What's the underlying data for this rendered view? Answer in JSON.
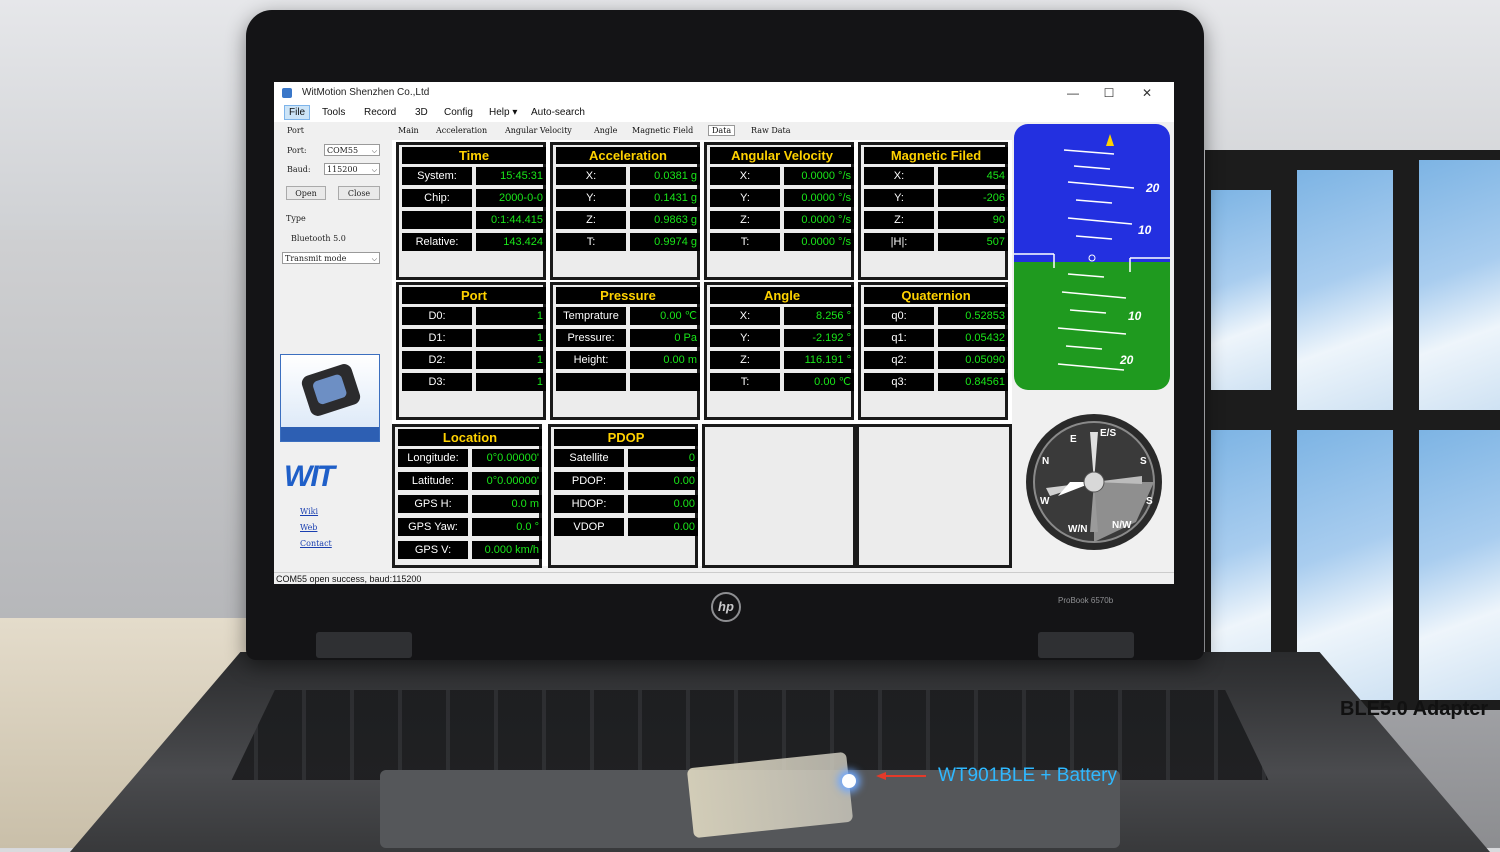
{
  "app": {
    "title": "WitMotion Shenzhen Co.,Ltd",
    "window_controls": {
      "minimize": "—",
      "maximize": "☐",
      "close": "✕"
    }
  },
  "menu": [
    "File",
    "Tools",
    "Record",
    "3D",
    "Config",
    "Help ▾",
    "Auto-search"
  ],
  "sidebar": {
    "port_group": "Port",
    "port_label": "Port:",
    "port_value": "COM55",
    "baud_label": "Baud:",
    "baud_value": "115200",
    "open_button": "Open",
    "close_button": "Close",
    "type_group": "Type",
    "type_value": "Bluetooth 5.0",
    "transmit_mode": "Transmit mode",
    "brand": "WIT",
    "links": [
      "Wiki",
      "Web",
      "Contact"
    ]
  },
  "tabs": [
    "Main",
    "Acceleration",
    "Angular Velocity",
    "Angle",
    "Magnetic Field",
    "Data",
    "Raw Data"
  ],
  "selected_tab": "Data",
  "panels": {
    "time": {
      "title": "Time",
      "rows": [
        {
          "label": "System:",
          "value": "15:45:31"
        },
        {
          "label": "Chip:",
          "value": "2000-0-0"
        },
        {
          "label": "",
          "value": "0:1:44.415"
        },
        {
          "label": "Relative:",
          "value": "143.424"
        }
      ]
    },
    "acceleration": {
      "title": "Acceleration",
      "rows": [
        {
          "label": "X:",
          "value": "0.0381 g"
        },
        {
          "label": "Y:",
          "value": "0.1431 g"
        },
        {
          "label": "Z:",
          "value": "0.9863 g"
        },
        {
          "label": "T:",
          "value": "0.9974 g"
        }
      ]
    },
    "angular_velocity": {
      "title": "Angular Velocity",
      "rows": [
        {
          "label": "X:",
          "value": "0.0000 °/s"
        },
        {
          "label": "Y:",
          "value": "0.0000 °/s"
        },
        {
          "label": "Z:",
          "value": "0.0000 °/s"
        },
        {
          "label": "T:",
          "value": "0.0000 °/s"
        }
      ]
    },
    "magnetic": {
      "title": "Magnetic Filed",
      "rows": [
        {
          "label": "X:",
          "value": "454"
        },
        {
          "label": "Y:",
          "value": "-206"
        },
        {
          "label": "Z:",
          "value": "90"
        },
        {
          "label": "|H|:",
          "value": "507"
        }
      ]
    },
    "port": {
      "title": "Port",
      "rows": [
        {
          "label": "D0:",
          "value": "1"
        },
        {
          "label": "D1:",
          "value": "1"
        },
        {
          "label": "D2:",
          "value": "1"
        },
        {
          "label": "D3:",
          "value": "1"
        }
      ]
    },
    "pressure": {
      "title": "Pressure",
      "rows": [
        {
          "label": "Temprature",
          "value": "0.00 ℃"
        },
        {
          "label": "Pressure:",
          "value": "0 Pa"
        },
        {
          "label": "Height:",
          "value": "0.00 m"
        },
        {
          "label": "",
          "value": ""
        }
      ]
    },
    "angle": {
      "title": "Angle",
      "rows": [
        {
          "label": "X:",
          "value": "8.256 °"
        },
        {
          "label": "Y:",
          "value": "-2.192 °"
        },
        {
          "label": "Z:",
          "value": "116.191 °"
        },
        {
          "label": "T:",
          "value": "0.00 ℃"
        }
      ]
    },
    "quaternion": {
      "title": "Quaternion",
      "rows": [
        {
          "label": "q0:",
          "value": "0.52853"
        },
        {
          "label": "q1:",
          "value": "0.05432"
        },
        {
          "label": "q2:",
          "value": "0.05090"
        },
        {
          "label": "q3:",
          "value": "0.84561"
        }
      ]
    },
    "location": {
      "title": "Location",
      "rows": [
        {
          "label": "Longitude:",
          "value": "0°0.00000'"
        },
        {
          "label": "Latitude:",
          "value": "0°0.00000'"
        },
        {
          "label": "GPS H:",
          "value": "0.0 m"
        },
        {
          "label": "GPS Yaw:",
          "value": "0.0 °"
        },
        {
          "label": "GPS V:",
          "value": "0.000 km/h"
        }
      ]
    },
    "pdop": {
      "title": "PDOP",
      "rows": [
        {
          "label": "Satellite",
          "value": "0"
        },
        {
          "label": "PDOP:",
          "value": "0.00"
        },
        {
          "label": "HDOP:",
          "value": "0.00"
        },
        {
          "label": "VDOP",
          "value": "0.00"
        }
      ]
    }
  },
  "attitude": {
    "labels": [
      "20",
      "10",
      "10",
      "20"
    ]
  },
  "compass": {
    "labels": [
      "E",
      "E/S",
      "N",
      "S",
      "W",
      "S",
      "W/N",
      "N/W"
    ]
  },
  "status": "COM55 open success, baud:115200",
  "laptop": {
    "brand": "hp",
    "model": "ProBook 6570b"
  },
  "captions": {
    "adapter": "BLE5.0 Adapter",
    "device": "WT901BLE + Battery"
  },
  "colors": {
    "value_green": "#19e619",
    "title_yellow": "#ffd200",
    "sky": "#2330e0",
    "ground": "#1f9a1f",
    "caption_blue": "#2fb8ff"
  }
}
